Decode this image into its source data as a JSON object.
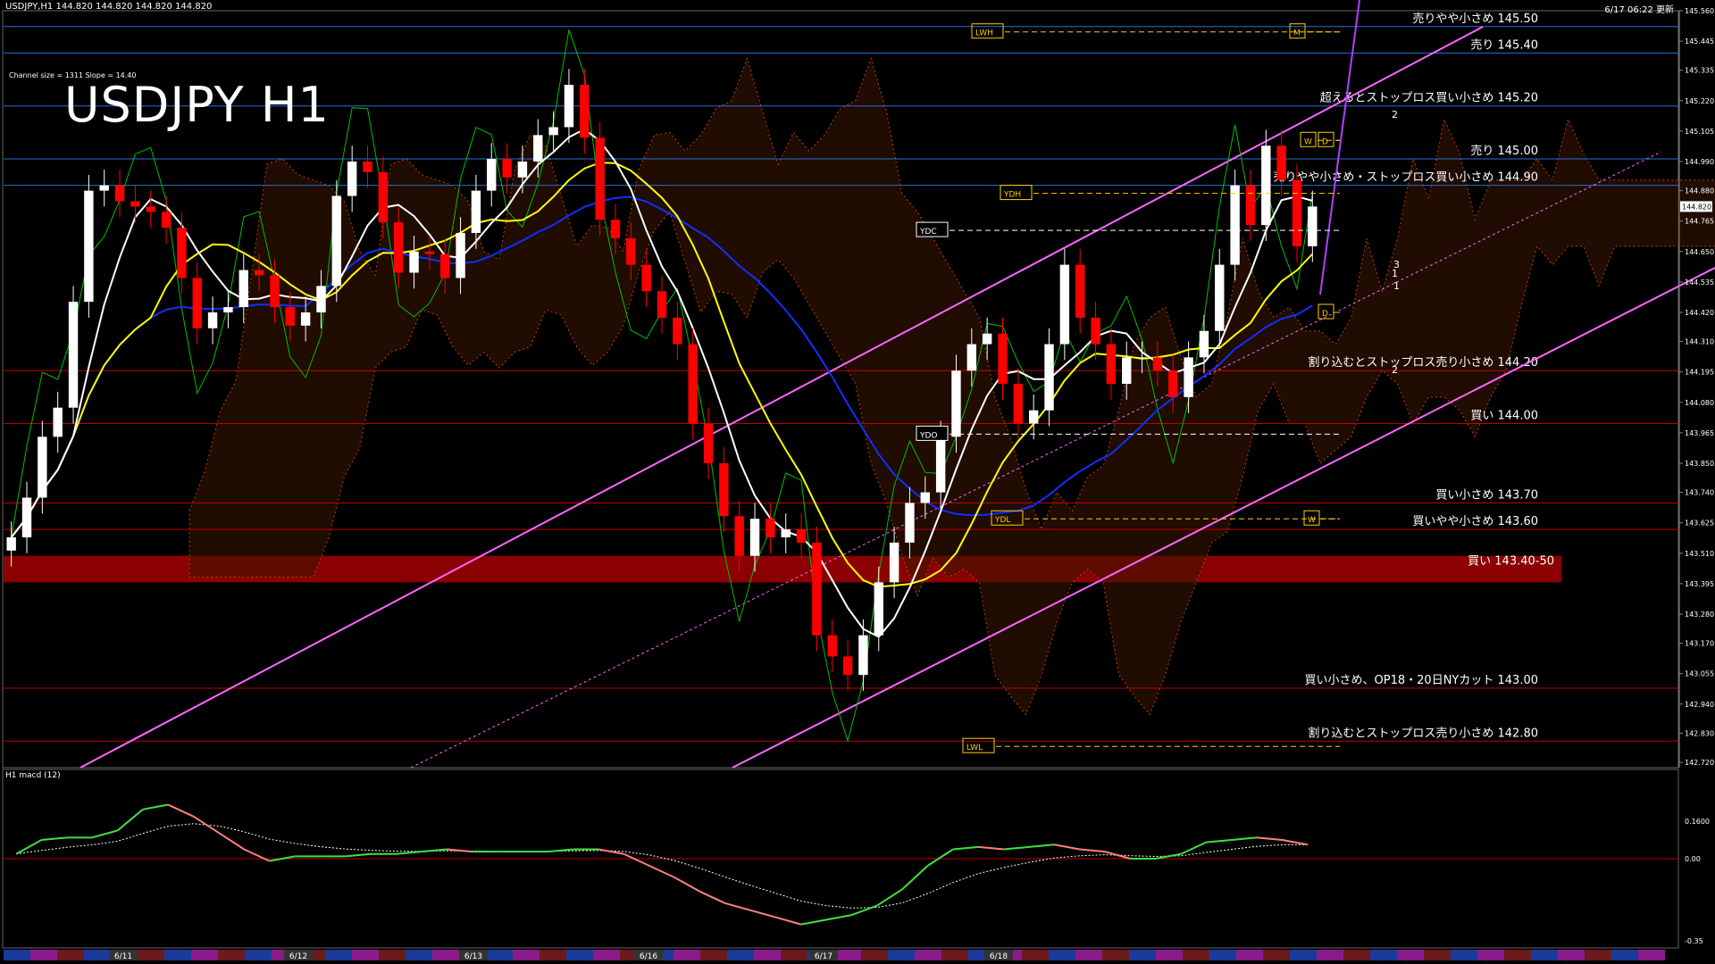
{
  "header": {
    "symbol_line": "USDJPY,H1  144.820 144.820 144.820 144.820",
    "updated": "6/17 06:22 更新"
  },
  "title": "USDJPY H1",
  "channel_info": "Channel size = 1311  Slope = 14.40",
  "macd_label": "H1  macd (12)",
  "colors": {
    "bg": "#000000",
    "grid_blue": "#2a6fd6",
    "level_red": "#c00000",
    "white_ma": "#ffffff",
    "yellow_ma": "#ffff00",
    "blue_ma": "#1030ff",
    "channel": "#ff66ff",
    "bull": "#ffffff",
    "bear": "#ff0000",
    "green_line": "#00c000",
    "cloud": "#c04000",
    "zone": "#8b0000"
  },
  "chart_data": [
    {
      "type": "line",
      "title": "USDJPY H1",
      "ylim": [
        142.72,
        145.56
      ],
      "y_ticks": [
        "145.560",
        "145.445",
        "145.335",
        "145.220",
        "145.105",
        "144.990",
        "144.880",
        "144.765",
        "144.650",
        "144.535",
        "144.420",
        "144.310",
        "144.195",
        "144.080",
        "143.965",
        "143.850",
        "143.740",
        "143.625",
        "143.510",
        "143.395",
        "143.280",
        "143.170",
        "143.055",
        "142.940",
        "142.830",
        "142.720"
      ],
      "current_price": "144.820",
      "x_labels": [
        "6/11",
        "6/12",
        "6/13",
        "6/16",
        "6/17",
        "6/18"
      ],
      "levels": [
        {
          "price": 145.5,
          "label": "売りやや小さめ 145.50",
          "kind": "blue"
        },
        {
          "price": 145.4,
          "label": "売り 145.40",
          "kind": "blue"
        },
        {
          "price": 145.2,
          "label": "超えるとストップロス買い小さめ 145.20",
          "kind": "blue"
        },
        {
          "price": 145.0,
          "label": "売り 145.00",
          "kind": "blue"
        },
        {
          "price": 144.9,
          "label": "売りやや小さめ・ストップロス買い小さめ 144.90",
          "kind": "blue"
        },
        {
          "price": 144.2,
          "label": "割り込むとストップロス売り小さめ 144.20",
          "kind": "red"
        },
        {
          "price": 144.0,
          "label": "買い 144.00",
          "kind": "red"
        },
        {
          "price": 143.7,
          "label": "買い小さめ 143.70",
          "kind": "red"
        },
        {
          "price": 143.6,
          "label": "買いやや小さめ 143.60",
          "kind": "red"
        },
        {
          "price": 143.45,
          "label": "買い 143.40-50",
          "kind": "zone"
        },
        {
          "price": 143.0,
          "label": "買い小さめ、OP18・20日NYカット 143.00",
          "kind": "red"
        },
        {
          "price": 142.8,
          "label": "割り込むとストップロス売り小さめ 142.80",
          "kind": "red"
        }
      ],
      "markers": [
        {
          "label": "LWH",
          "price": 145.48
        },
        {
          "label": "YDH",
          "price": 144.87
        },
        {
          "label": "YDC",
          "price": 144.73
        },
        {
          "label": "YDO",
          "price": 143.96
        },
        {
          "label": "YDL",
          "price": 143.64
        },
        {
          "label": "LWL",
          "price": 142.78
        },
        {
          "label": "M",
          "price": 145.48
        },
        {
          "label": "W",
          "price": 145.07
        },
        {
          "label": "D",
          "price": 145.07
        },
        {
          "label": "D",
          "price": 144.42
        },
        {
          "label": "W",
          "price": 143.64
        }
      ],
      "wave_labels": [
        "1",
        "2",
        "3",
        "1",
        "2"
      ],
      "series": [
        {
          "name": "close",
          "values": [
            143.57,
            143.72,
            143.95,
            144.06,
            144.46,
            144.88,
            144.9,
            144.84,
            144.82,
            144.8,
            144.74,
            144.55,
            144.36,
            144.42,
            144.44,
            144.58,
            144.56,
            144.44,
            144.37,
            144.42,
            144.52,
            144.86,
            144.99,
            144.95,
            144.76,
            144.57,
            144.65,
            144.64,
            144.55,
            144.72,
            144.88,
            145.0,
            144.93,
            144.99,
            145.09,
            145.12,
            145.28,
            145.08,
            144.77,
            144.7,
            144.6,
            144.5,
            144.4,
            144.3,
            144.0,
            143.85,
            143.65,
            143.5,
            143.64,
            143.57,
            143.6,
            143.55,
            143.2,
            143.12,
            143.05,
            143.2,
            143.4,
            143.55,
            143.7,
            143.74,
            143.95,
            144.2,
            144.3,
            144.34,
            144.15,
            144.0,
            144.05,
            144.3,
            144.6,
            144.4,
            144.3,
            144.15,
            144.25,
            144.25,
            144.2,
            144.1,
            144.25,
            144.35,
            144.6,
            144.9,
            144.75,
            145.05,
            144.92,
            144.67,
            144.82
          ]
        },
        {
          "name": "macd",
          "values": [
            0.02,
            0.08,
            0.09,
            0.09,
            0.12,
            0.21,
            0.23,
            0.18,
            0.11,
            0.04,
            -0.01,
            0.01,
            0.01,
            0.01,
            0.02,
            0.02,
            0.03,
            0.04,
            0.03,
            0.03,
            0.03,
            0.03,
            0.04,
            0.04,
            0.02,
            -0.03,
            -0.08,
            -0.14,
            -0.19,
            -0.22,
            -0.25,
            -0.28,
            -0.26,
            -0.24,
            -0.2,
            -0.13,
            -0.03,
            0.04,
            0.05,
            0.04,
            0.05,
            0.06,
            0.04,
            0.03,
            0.0,
            0.0,
            0.02,
            0.07,
            0.08,
            0.09,
            0.08,
            0.06
          ]
        }
      ]
    }
  ]
}
